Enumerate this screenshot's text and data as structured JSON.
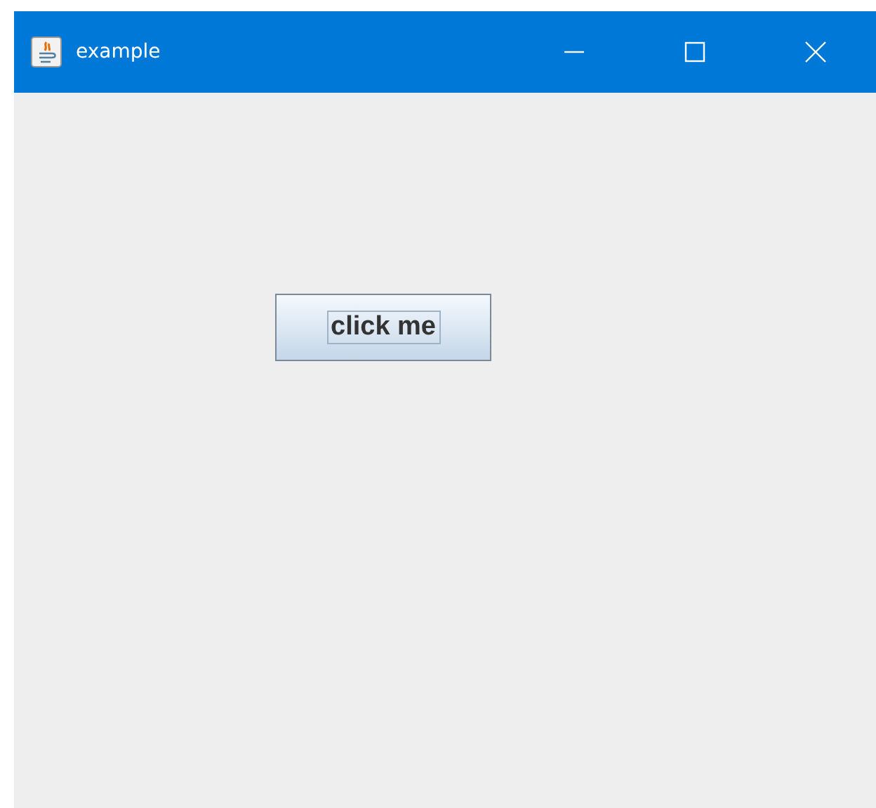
{
  "window": {
    "title": "example"
  },
  "button": {
    "label": "click me",
    "focused": true
  }
}
